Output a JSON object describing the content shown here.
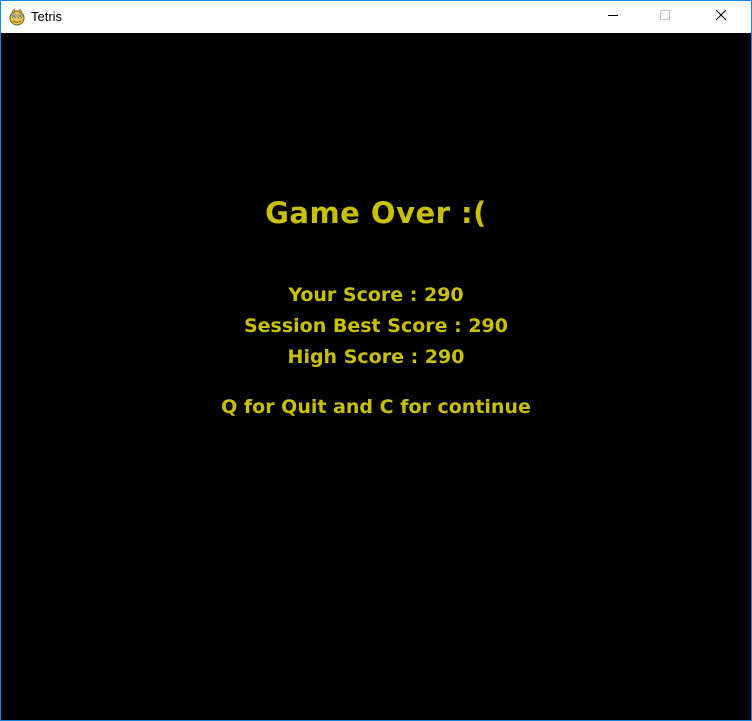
{
  "window": {
    "title": "Tetris",
    "app_icon": "pygame-snake-icon"
  },
  "game_over": {
    "title": "Game Over :(",
    "your_score": "Your Score : 290",
    "session_best": "Session Best Score : 290",
    "high_score": "High Score : 290",
    "instructions": "Q for Quit and C for continue"
  },
  "colors": {
    "text": "#c8c000",
    "background": "#000000",
    "window_border": "#1883d7"
  }
}
